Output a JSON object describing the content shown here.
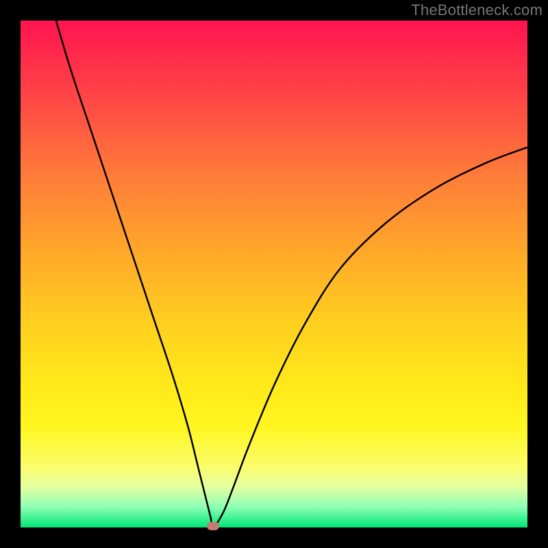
{
  "watermark": "TheBottleneck.com",
  "chart_data": {
    "type": "line",
    "title": "",
    "xlabel": "",
    "ylabel": "",
    "xlim": [
      0,
      100
    ],
    "ylim": [
      0,
      100
    ],
    "grid": false,
    "legend": false,
    "background_gradient": {
      "top": "#ff1450",
      "bottom": "#00e676",
      "meaning": "red=bad, green=good"
    },
    "series": [
      {
        "name": "bottleneck-curve",
        "x": [
          7,
          10,
          14,
          18,
          22,
          26,
          30,
          33,
          35,
          36.5,
          37.5,
          38,
          40,
          42,
          45,
          50,
          56,
          63,
          72,
          82,
          92,
          100
        ],
        "y": [
          100,
          90,
          78,
          66,
          54,
          42,
          30,
          20,
          12,
          6,
          2,
          0,
          3,
          8,
          16,
          28,
          40,
          51,
          60,
          67,
          72,
          75
        ]
      }
    ],
    "marker": {
      "name": "optimal-point",
      "x": 38,
      "y": 0,
      "color": "#c77b74"
    }
  }
}
